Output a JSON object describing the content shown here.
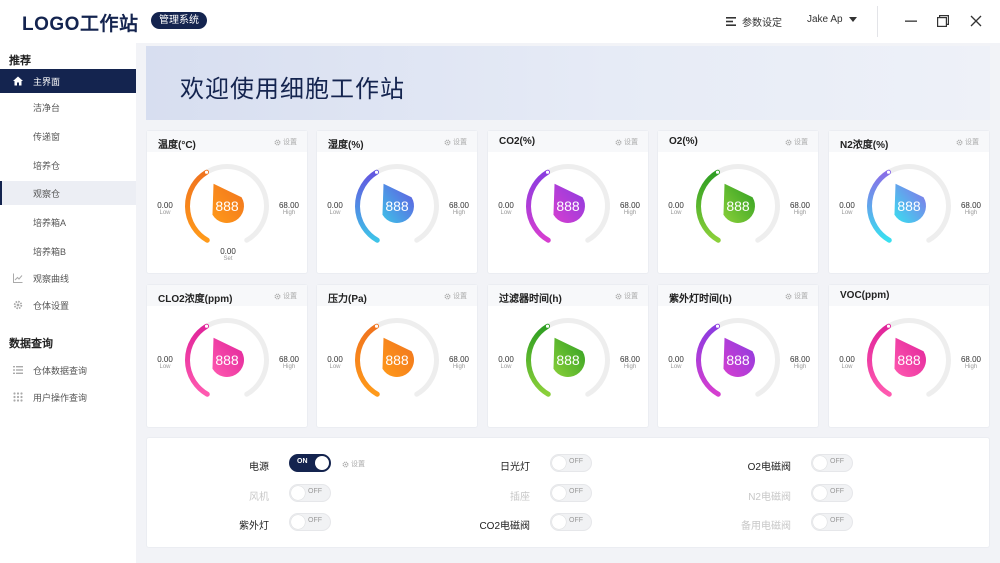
{
  "header": {
    "logo": "LOGO工作站",
    "badge": "管理系统",
    "settings_label": "参数设定",
    "user_name": "Jake Ap"
  },
  "sidebar": {
    "section1_title": "推荐",
    "items": [
      {
        "label": "主界面",
        "icon": "home-icon"
      },
      {
        "label": "洁净台"
      },
      {
        "label": "传递窗"
      },
      {
        "label": "培养仓"
      },
      {
        "label": "观察仓"
      },
      {
        "label": "培养箱A"
      },
      {
        "label": "培养箱B"
      },
      {
        "label": "观察曲线",
        "icon": "line-chart-icon"
      },
      {
        "label": "仓体设置",
        "icon": "gear-icon"
      }
    ],
    "section2_title": "数据查询",
    "items2": [
      {
        "label": "仓体数据查询",
        "icon": "list-icon"
      },
      {
        "label": "用户操作查询",
        "icon": "grid-icon"
      }
    ]
  },
  "banner": {
    "title": "欢迎使用细胞工作站"
  },
  "cards": [
    {
      "title": "温度(°C)",
      "value": "888",
      "low": "0.00",
      "low_label": "Low",
      "high": "68.00",
      "high_label": "High",
      "set": "0.00",
      "set_label": "Set",
      "settings_label": "设置",
      "color_start": "#ff9a1a",
      "color_end": "#f0731e",
      "level": 0.33
    },
    {
      "title": "湿度(%)",
      "value": "888",
      "low": "0.00",
      "low_label": "Low",
      "high": "68.00",
      "high_label": "High",
      "settings_label": "设置",
      "color_start": "#3ec3e8",
      "color_end": "#6355e0",
      "level": 0.33
    },
    {
      "title": "CO2(%)",
      "value": "888",
      "low": "0.00",
      "low_label": "Low",
      "high": "68.00",
      "high_label": "High",
      "settings_label": "设置",
      "color_start": "#d63ed0",
      "color_end": "#8a3ce0",
      "level": 0.33
    },
    {
      "title": "O2(%)",
      "value": "888",
      "low": "0.00",
      "low_label": "Low",
      "high": "68.00",
      "high_label": "High",
      "settings_label": "设置",
      "color_start": "#8bd03a",
      "color_end": "#2e9e22",
      "level": 0.33
    },
    {
      "title": "N2浓度(%)",
      "value": "888",
      "low": "0.00",
      "low_label": "Low",
      "high": "68.00",
      "high_label": "High",
      "settings_label": "设置",
      "color_start": "#38e0f0",
      "color_end": "#8a6de8",
      "level": 0.33
    },
    {
      "title": "CLO2浓度(ppm)",
      "value": "888",
      "low": "0.00",
      "low_label": "Low",
      "high": "68.00",
      "high_label": "High",
      "settings_label": "设置",
      "color_start": "#ff5ab0",
      "color_end": "#e0249a",
      "level": 0.33
    },
    {
      "title": "压力(Pa)",
      "value": "888",
      "low": "0.00",
      "low_label": "Low",
      "high": "68.00",
      "high_label": "High",
      "settings_label": "设置",
      "color_start": "#ff9a1a",
      "color_end": "#f0731e",
      "level": 0.33
    },
    {
      "title": "过滤器时间(h)",
      "value": "888",
      "low": "0.00",
      "low_label": "Low",
      "high": "68.00",
      "high_label": "High",
      "settings_label": "设置",
      "color_start": "#8bd03a",
      "color_end": "#2e9e22",
      "level": 0.33
    },
    {
      "title": "紫外灯时间(h)",
      "value": "888",
      "low": "0.00",
      "low_label": "Low",
      "high": "68.00",
      "high_label": "High",
      "settings_label": "设置",
      "color_start": "#d63ed0",
      "color_end": "#8a3ce0",
      "level": 0.33
    },
    {
      "title": "VOC(ppm)",
      "value": "888",
      "low": "0.00",
      "low_label": "Low",
      "high": "68.00",
      "high_label": "High",
      "color_start": "#ff5ab0",
      "color_end": "#e0249a",
      "level": 0.33
    }
  ],
  "controls": {
    "settings_label": "设置",
    "on_text": "ON",
    "off_text": "OFF",
    "items": [
      {
        "label": "电源",
        "state": "on",
        "enabled": true
      },
      {
        "label": "日光灯",
        "state": "off",
        "enabled": true
      },
      {
        "label": "O2电磁阀",
        "state": "off",
        "enabled": true
      },
      {
        "label": "风机",
        "state": "off",
        "enabled": false
      },
      {
        "label": "插座",
        "state": "off",
        "enabled": false
      },
      {
        "label": "N2电磁阀",
        "state": "off",
        "enabled": false
      },
      {
        "label": "紫外灯",
        "state": "off",
        "enabled": true
      },
      {
        "label": "CO2电磁阀",
        "state": "off",
        "enabled": true
      },
      {
        "label": "备用电磁阀",
        "state": "off",
        "enabled": false
      }
    ]
  },
  "colors": {
    "brand": "#14244f",
    "track": "#eeeeee"
  }
}
